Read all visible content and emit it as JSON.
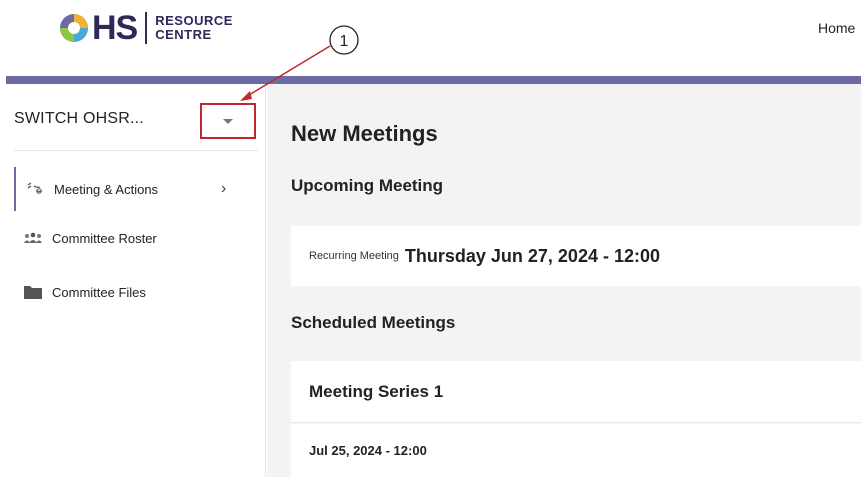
{
  "header": {
    "logo": {
      "mark_text": "OHS",
      "line1": "RESOURCE",
      "line2": "CENTRE"
    },
    "nav_home": "Home"
  },
  "sidebar": {
    "switch_label": "SWITCH OHSR...",
    "items": [
      {
        "label": "Meeting & Actions",
        "icon": "meeting-actions-icon",
        "active": true,
        "has_chevron": true
      },
      {
        "label": "Committee Roster",
        "icon": "roster-icon",
        "active": false
      },
      {
        "label": "Committee Files",
        "icon": "folder-icon",
        "active": false
      }
    ],
    "chevron": "›"
  },
  "main": {
    "page_title": "New Meetings",
    "upcoming": {
      "title": "Upcoming Meeting",
      "recurring_label": "Recurring Meeting",
      "date": "Thursday Jun 27, 2024 - 12:00"
    },
    "scheduled": {
      "title": "Scheduled Meetings",
      "series_title": "Meeting Series 1",
      "series_date": "Jul 25, 2024 - 12:00"
    }
  },
  "annotation": {
    "number": "1"
  },
  "colors": {
    "brand": "#2d2a5a",
    "accent": "#6b6aa3",
    "annotation_red": "#c0272d",
    "main_bg": "#f3f3f3"
  }
}
